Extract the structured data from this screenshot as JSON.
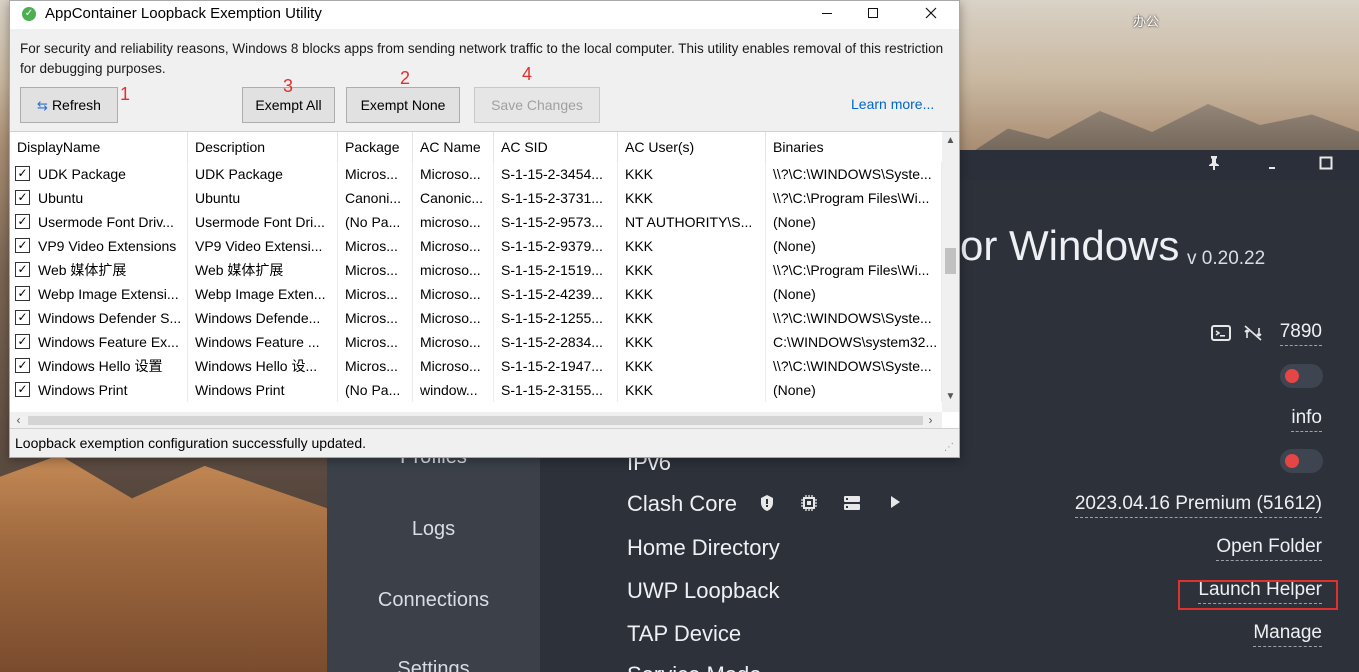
{
  "desktop": {
    "label": "办公"
  },
  "clash": {
    "titlebar": {
      "pin_icon": "pin-icon",
      "minimize_icon": "minimize-icon",
      "maximize_icon": "maximize-icon"
    },
    "title": "or Windows",
    "version": "v 0.20.22",
    "nav": [
      "Profiles",
      "Logs",
      "Connections",
      "Settings"
    ],
    "port": "7890",
    "log_level": "info",
    "ipv6_label": "IPv6",
    "core": {
      "label": "Clash Core",
      "value": "2023.04.16 Premium (51612)"
    },
    "home_dir": {
      "label": "Home Directory",
      "value": "Open Folder"
    },
    "uwp": {
      "label": "UWP Loopback",
      "value": "Launch Helper"
    },
    "tap": {
      "label": "TAP Device",
      "value": "Manage"
    },
    "service_mode": {
      "label": "Service Mode"
    },
    "accent_red": "#e0312f"
  },
  "loopback": {
    "title": "AppContainer Loopback Exemption Utility",
    "description": "For security and reliability reasons, Windows 8 blocks apps from sending network traffic to the local computer. This utility enables removal of this restriction for debugging purposes.",
    "buttons": {
      "refresh": "Refresh",
      "exempt_all": "Exempt All",
      "exempt_none": "Exempt None",
      "save_changes": "Save Changes"
    },
    "annotations": {
      "refresh": "1",
      "exempt_none": "2",
      "exempt_all": "3",
      "save_changes": "4"
    },
    "learn_more": "Learn more...",
    "columns": [
      "DisplayName",
      "Description",
      "Package",
      "AC Name",
      "AC SID",
      "AC User(s)",
      "Binaries"
    ],
    "rows": [
      [
        "UDK Package",
        "UDK Package",
        "Micros...",
        "Microso...",
        "S-1-15-2-3454...",
        "KKK",
        "\\\\?\\C:\\WINDOWS\\Syste..."
      ],
      [
        "Ubuntu",
        "Ubuntu",
        "Canoni...",
        "Canonic...",
        "S-1-15-2-3731...",
        "KKK",
        "\\\\?\\C:\\Program Files\\Wi..."
      ],
      [
        "Usermode Font Driv...",
        "Usermode Font Dri...",
        "(No Pa...",
        "microso...",
        "S-1-15-2-9573...",
        "NT AUTHORITY\\S...",
        "(None)"
      ],
      [
        "VP9 Video Extensions",
        "VP9 Video Extensi...",
        "Micros...",
        "Microso...",
        "S-1-15-2-9379...",
        "KKK",
        "(None)"
      ],
      [
        "Web 媒体扩展",
        "Web 媒体扩展",
        "Micros...",
        "microso...",
        "S-1-15-2-1519...",
        "KKK",
        "\\\\?\\C:\\Program Files\\Wi..."
      ],
      [
        "Webp Image Extensi...",
        "Webp Image Exten...",
        "Micros...",
        "Microso...",
        "S-1-15-2-4239...",
        "KKK",
        "(None)"
      ],
      [
        "Windows Defender S...",
        "Windows Defende...",
        "Micros...",
        "Microso...",
        "S-1-15-2-1255...",
        "KKK",
        "\\\\?\\C:\\WINDOWS\\Syste..."
      ],
      [
        "Windows Feature Ex...",
        "Windows Feature ...",
        "Micros...",
        "Microso...",
        "S-1-15-2-2834...",
        "KKK",
        "C:\\WINDOWS\\system32..."
      ],
      [
        "Windows Hello 设置",
        "Windows Hello 设...",
        "Micros...",
        "Microso...",
        "S-1-15-2-1947...",
        "KKK",
        "\\\\?\\C:\\WINDOWS\\Syste..."
      ],
      [
        "Windows Print",
        "Windows Print",
        "(No Pa...",
        "window...",
        "S-1-15-2-3155...",
        "KKK",
        "(None)"
      ]
    ],
    "status": "Loopback exemption configuration successfully updated."
  }
}
